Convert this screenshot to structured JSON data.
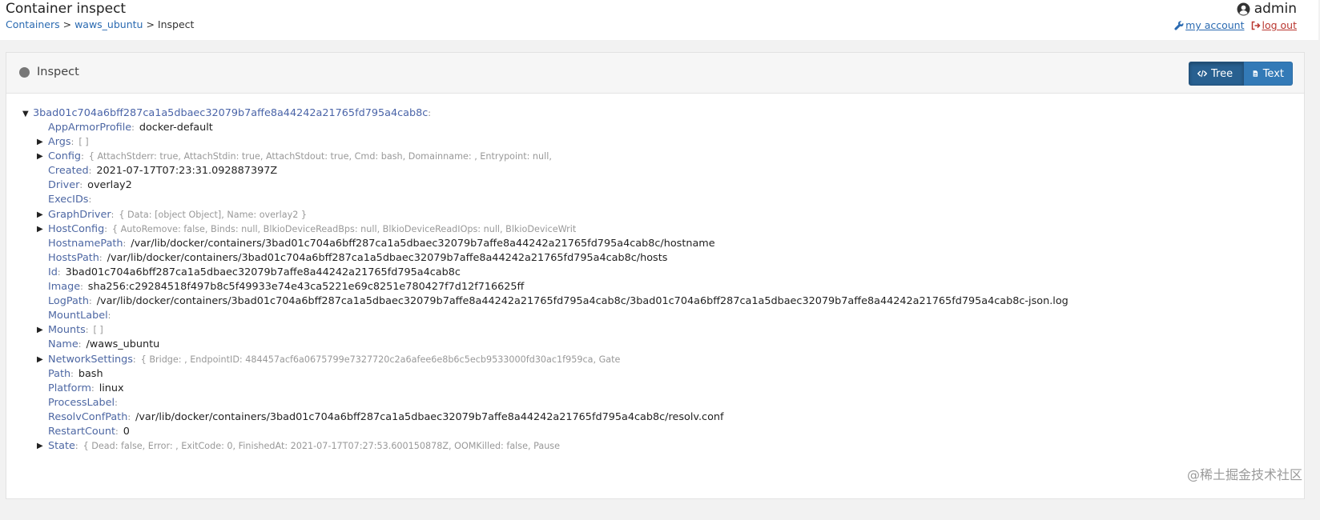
{
  "header": {
    "title": "Container inspect",
    "breadcrumb": {
      "containers": "Containers",
      "separator": ">",
      "container_name": "waws_ubuntu",
      "current": "Inspect"
    },
    "user": {
      "name": "admin",
      "my_account": "my account",
      "log_out": "log out"
    }
  },
  "panel": {
    "title": "Inspect",
    "buttons": {
      "tree": "Tree",
      "text": "Text"
    }
  },
  "tree": {
    "root_key": "3bad01c704a6bff287ca1a5dbaec32079b7affe8a44242a21765fd795a4cab8c",
    "rows": [
      {
        "key": "AppArmorProfile",
        "value": "docker-default",
        "expandable": false
      },
      {
        "key": "Args",
        "preview": "[ ]",
        "expandable": true
      },
      {
        "key": "Config",
        "preview": "{ AttachStderr: true, AttachStdin: true, AttachStdout: true, Cmd: bash, Domainname: , Entrypoint: null,",
        "expandable": true
      },
      {
        "key": "Created",
        "value": "2021-07-17T07:23:31.092887397Z",
        "expandable": false
      },
      {
        "key": "Driver",
        "value": "overlay2",
        "expandable": false
      },
      {
        "key": "ExecIDs",
        "value": "",
        "expandable": false
      },
      {
        "key": "GraphDriver",
        "preview": "{ Data: [object Object], Name: overlay2 }",
        "expandable": true
      },
      {
        "key": "HostConfig",
        "preview": "{ AutoRemove: false, Binds: null, BlkioDeviceReadBps: null, BlkioDeviceReadIOps: null, BlkioDeviceWrit",
        "expandable": true
      },
      {
        "key": "HostnamePath",
        "value": "/var/lib/docker/containers/3bad01c704a6bff287ca1a5dbaec32079b7affe8a44242a21765fd795a4cab8c/hostname",
        "expandable": false
      },
      {
        "key": "HostsPath",
        "value": "/var/lib/docker/containers/3bad01c704a6bff287ca1a5dbaec32079b7affe8a44242a21765fd795a4cab8c/hosts",
        "expandable": false
      },
      {
        "key": "Id",
        "value": "3bad01c704a6bff287ca1a5dbaec32079b7affe8a44242a21765fd795a4cab8c",
        "expandable": false
      },
      {
        "key": "Image",
        "value": "sha256:c29284518f497b8c5f49933e74e43ca5221e69c8251e780427f7d12f716625ff",
        "expandable": false
      },
      {
        "key": "LogPath",
        "value": "/var/lib/docker/containers/3bad01c704a6bff287ca1a5dbaec32079b7affe8a44242a21765fd795a4cab8c/3bad01c704a6bff287ca1a5dbaec32079b7affe8a44242a21765fd795a4cab8c-json.log",
        "expandable": false
      },
      {
        "key": "MountLabel",
        "value": "",
        "expandable": false
      },
      {
        "key": "Mounts",
        "preview": "[ ]",
        "expandable": true
      },
      {
        "key": "Name",
        "value": "/waws_ubuntu",
        "expandable": false
      },
      {
        "key": "NetworkSettings",
        "preview": "{ Bridge: , EndpointID: 484457acf6a0675799e7327720c2a6afee6e8b6c5ecb9533000fd30ac1f959ca, Gate",
        "expandable": true
      },
      {
        "key": "Path",
        "value": "bash",
        "expandable": false
      },
      {
        "key": "Platform",
        "value": "linux",
        "expandable": false
      },
      {
        "key": "ProcessLabel",
        "value": "",
        "expandable": false
      },
      {
        "key": "ResolvConfPath",
        "value": "/var/lib/docker/containers/3bad01c704a6bff287ca1a5dbaec32079b7affe8a44242a21765fd795a4cab8c/resolv.conf",
        "expandable": false
      },
      {
        "key": "RestartCount",
        "value": "0",
        "expandable": false
      },
      {
        "key": "State",
        "preview": "{ Dead: false, Error: , ExitCode: 0, FinishedAt: 2021-07-17T07:27:53.600150878Z, OOMKilled: false, Pause",
        "expandable": true
      }
    ]
  },
  "watermark": "@稀土掘金技术社区",
  "colors": {
    "link": "#2a6ab1",
    "logout": "#b9362f",
    "tree_key": "#4d67a3",
    "btn_active": "#286090",
    "btn": "#337ab7"
  },
  "icons": {
    "user": "user-circle-icon",
    "account": "wrench-icon",
    "logout": "sign-out-icon",
    "tree": "code-icon",
    "text": "file-text-icon"
  }
}
